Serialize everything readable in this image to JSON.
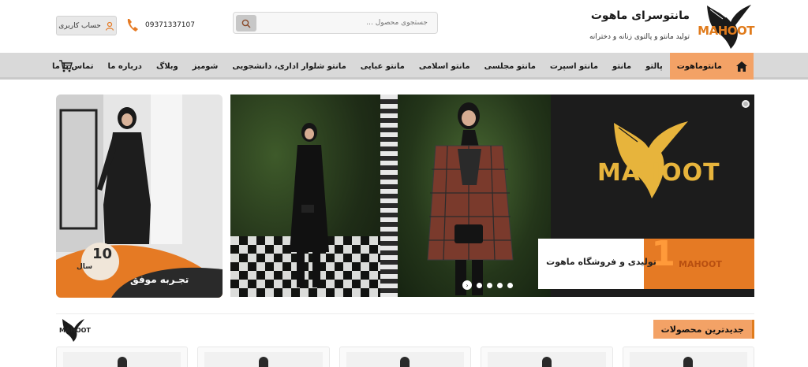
{
  "header": {
    "brand_title": "مانتوسرای ماهوت",
    "brand_subtitle": "تولید مانتو و پالتوی زنانه و دخترانه",
    "logo_text": "MAHOOT",
    "search_placeholder": "جستجوی محصول ...",
    "phone": "09371337107",
    "account_label": "حساب کاربری"
  },
  "nav": {
    "items": [
      {
        "label": "مانتوماهوت",
        "active": true
      },
      {
        "label": "پالتو"
      },
      {
        "label": "مانتو"
      },
      {
        "label": "مانتو اسپرت"
      },
      {
        "label": "مانتو مجلسی"
      },
      {
        "label": "مانتو اسلامی"
      },
      {
        "label": "مانتو عبایی"
      },
      {
        "label": "مانتو شلوار اداری، دانشجویی"
      },
      {
        "label": "شومیز"
      },
      {
        "label": "وبلاگ"
      },
      {
        "label": "درباره ما"
      },
      {
        "label": "تماس با ما"
      }
    ]
  },
  "side_banner": {
    "badge_number": "10",
    "badge_unit": "سال",
    "caption": "تجـربه موفق"
  },
  "slider": {
    "brand_logo": "MAHOOT",
    "band_number": "1",
    "band_logo": "MAHOOT",
    "band_text": "تولیدی و فروشگاه ماهوت",
    "dot_count": 4
  },
  "new_products": {
    "title": "جدیدترین محصولات",
    "logo_text": "MAHOOT",
    "card_count": 5
  },
  "colors": {
    "accent_orange": "#f3a266",
    "brand_orange": "#e57a24",
    "gold": "#e7b43c",
    "nav_bg": "#d9d9d9"
  }
}
